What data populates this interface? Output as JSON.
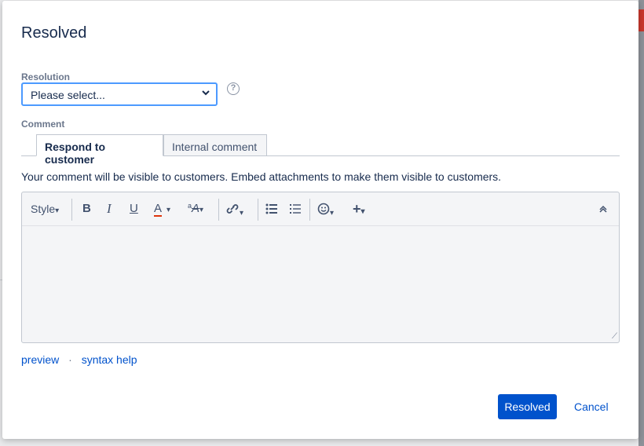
{
  "dialog": {
    "title": "Resolved",
    "resolution_label": "Resolution",
    "resolution_value": "Please select...",
    "comment_label": "Comment",
    "tabs": [
      {
        "label": "Respond to customer",
        "active": true
      },
      {
        "label": "Internal comment",
        "active": false
      }
    ],
    "notice": "Your comment will be visible to customers. Embed attachments to make them visible to customers.",
    "toolbar": {
      "style_label": "Style",
      "icons": [
        "bold-icon",
        "italic-icon",
        "underline-icon",
        "text-color-icon",
        "text-format-icon",
        "link-icon",
        "bullet-list-icon",
        "numbered-list-icon",
        "emoji-icon",
        "insert-more-icon",
        "collapse-toolbar-icon"
      ]
    },
    "links": {
      "preview": "preview",
      "separator": "·",
      "syntax_help": "syntax help"
    },
    "buttons": {
      "submit": "Resolved",
      "cancel": "Cancel"
    }
  },
  "colors": {
    "primary": "#0052cc",
    "focus": "#4c9aff",
    "text": "#172b4d",
    "red_accent": "#de350b"
  }
}
